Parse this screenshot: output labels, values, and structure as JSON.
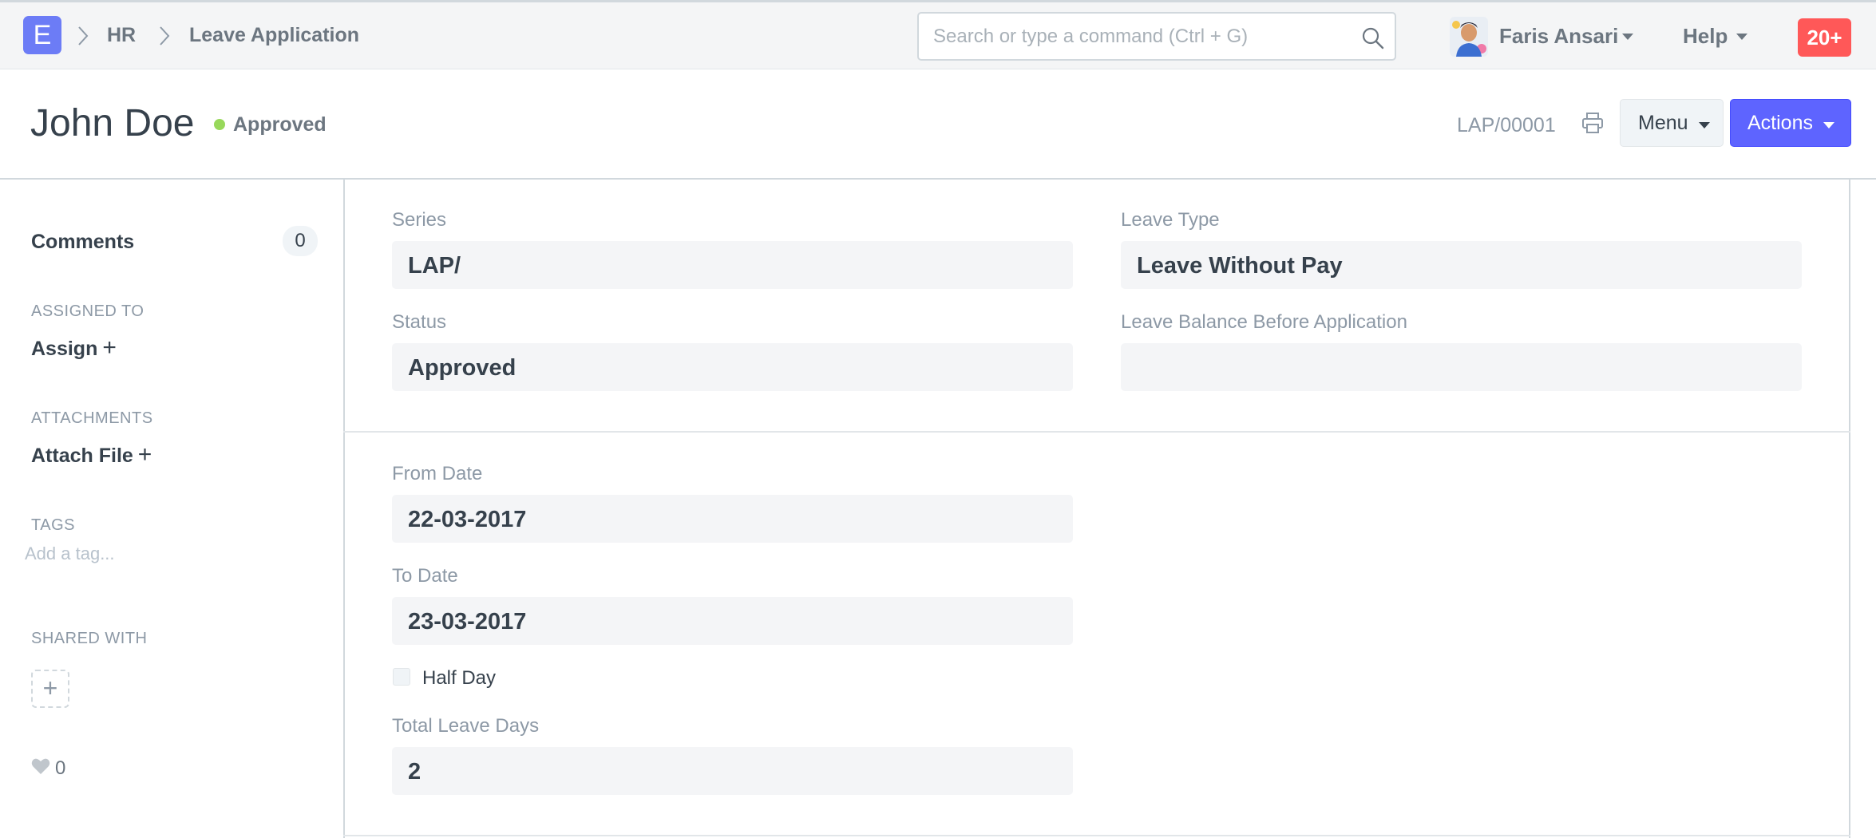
{
  "navbar": {
    "logo": "E",
    "breadcrumbs": [
      "HR",
      "Leave Application"
    ],
    "search_placeholder": "Search or type a command (Ctrl + G)",
    "user_name": "Faris Ansari",
    "help_label": "Help",
    "notification_count": "20+"
  },
  "page": {
    "title": "John Doe",
    "status": "Approved",
    "doc_name": "LAP/00001",
    "menu_label": "Menu",
    "actions_label": "Actions"
  },
  "sidebar": {
    "comments_label": "Comments",
    "comments_count": "0",
    "assigned_to_label": "ASSIGNED TO",
    "assign_label": "Assign",
    "attachments_label": "ATTACHMENTS",
    "attach_label": "Attach File",
    "tags_label": "TAGS",
    "tag_placeholder": "Add a tag...",
    "shared_with_label": "SHARED WITH",
    "share_add": "+",
    "likes_count": "0"
  },
  "form": {
    "series": {
      "label": "Series",
      "value": "LAP/"
    },
    "leave_type": {
      "label": "Leave Type",
      "value": "Leave Without Pay"
    },
    "status": {
      "label": "Status",
      "value": "Approved"
    },
    "leave_balance": {
      "label": "Leave Balance Before Application",
      "value": ""
    },
    "from_date": {
      "label": "From Date",
      "value": "22-03-2017"
    },
    "to_date": {
      "label": "To Date",
      "value": "23-03-2017"
    },
    "half_day": {
      "label": "Half Day",
      "checked": false
    },
    "total_leave_days": {
      "label": "Total Leave Days",
      "value": "2"
    }
  },
  "colors": {
    "primary": "#5e64ff",
    "status_approved": "#98d85b",
    "notification": "#ff5858",
    "logo": "#6c7cf6"
  },
  "icons": [
    "chevron-right-icon",
    "search-icon",
    "caret-down-icon",
    "printer-icon",
    "plus-icon",
    "heart-icon"
  ]
}
